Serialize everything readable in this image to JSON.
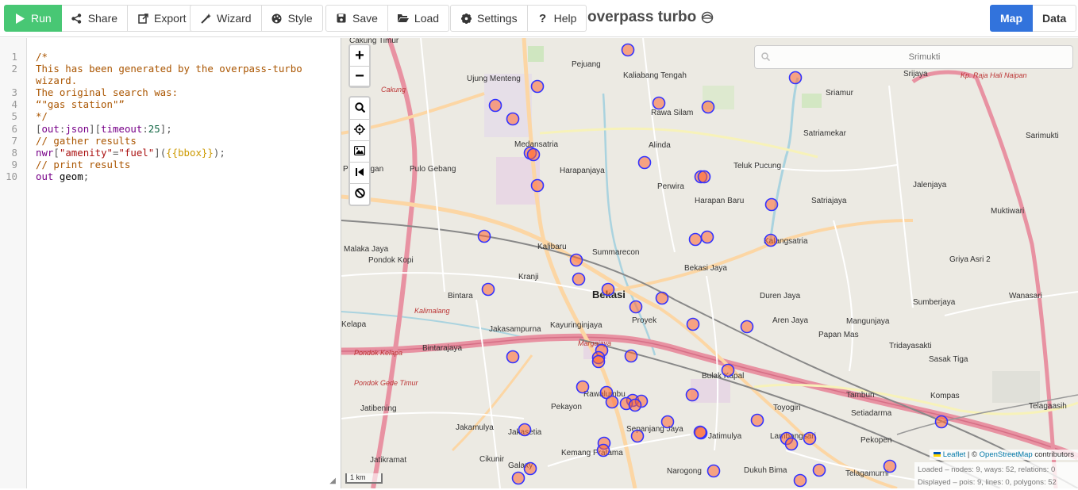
{
  "toolbar": {
    "run_label": "Run",
    "share_label": "Share",
    "export_label": "Export",
    "wizard_label": "Wizard",
    "style_label": "Style",
    "save_label": "Save",
    "load_label": "Load",
    "settings_label": "Settings",
    "help_label": "Help",
    "app_title": "overpass turbo",
    "map_tab_label": "Map",
    "data_tab_label": "Data",
    "active_tab": "Map",
    "colors": {
      "run": "#48c774",
      "active_tab": "#3273dc"
    }
  },
  "editor": {
    "line_numbers": [
      "1",
      "2",
      "3",
      "4",
      "5",
      "6",
      "7",
      "8",
      "9",
      "10"
    ],
    "lines": [
      "/*",
      "This has been generated by the overpass-turbo",
      "wizard.",
      "The original search was:",
      "“\"gas station\"”",
      "*/",
      "[out:json][timeout:25];",
      "// gather results",
      "nwr[\"amenity\"=\"fuel\"]({{bbox}});",
      "// print results",
      "out geom;"
    ]
  },
  "map": {
    "search_placeholder": "Srimukti",
    "scale_label": "1 km",
    "attribution": {
      "leaflet": "Leaflet",
      "separator": " | © ",
      "osm": "OpenStreetMap",
      "suffix": " contributors"
    },
    "stats": {
      "loaded": "Loaded – nodes: 9, ways: 52, relations: 0",
      "displayed": "Displayed – pois: 9, lines: 0, polygons: 52"
    },
    "places": [
      "Cakung Timur",
      "Pejuang",
      "Kaliabang Tengah",
      "Srijaya",
      "Kp. Raja Hali Naipan",
      "Ujung Menteng",
      "Cakung",
      "Rawa Silam",
      "Sriamur",
      "Medansatria",
      "Alinda",
      "Satriamekar",
      "Sarimukti",
      "Pulo Gebang",
      "Harapanjaya",
      "Teluk Pucung",
      "Pengangan",
      "Perwira",
      "Harapan Baru",
      "Satriajaya",
      "Jalenjaya",
      "Muktiwari",
      "Malaka Jaya",
      "Kalibaru",
      "Summarecon",
      "Kalangsatria",
      "Griya Asri 2",
      "Pondok Kopi",
      "Bintara",
      "Kranji",
      "Bekasi Jaya",
      "Bekasi",
      "Duren Jaya",
      "Sumberjaya",
      "Wanasari",
      "Jakasampurna",
      "Kayuringinjaya",
      "Proyek",
      "Aren Jaya",
      "Mangunjaya",
      "Kelapa",
      "Papan Mas",
      "Kalimalang",
      "Bintarajaya",
      "Margajaya",
      "Tridayasakti",
      "Sasak Tiga",
      "Bulak Kapal",
      "Tambun",
      "Kompas",
      "Jatibening",
      "Pekayon",
      "Toyogiri",
      "Setiadarma",
      "Telagaasih",
      "Rawalumbu",
      "Jakamulya",
      "Jakasetia",
      "Sepanjang Jaya",
      "Jatimulya",
      "Lambangsari",
      "Pekopen",
      "Kemang Pratama",
      "Cikunir",
      "Galaxy",
      "Jatikramat",
      "Narogong",
      "Dukuh Bima",
      "Telagamurni",
      "Pondok Gede Timur",
      "Pondok Kelapa"
    ]
  }
}
